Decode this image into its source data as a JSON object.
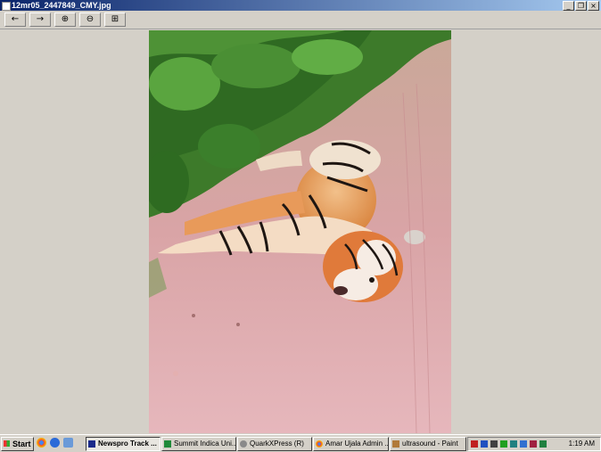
{
  "window": {
    "title": "12mr05_2447849_CMY.jpg",
    "minimize_glyph": "_",
    "restore_glyph": "❐",
    "close_glyph": "×"
  },
  "toolbar": {
    "back_glyph": "←",
    "forward_glyph": "→",
    "zoom_in_glyph": "⊕",
    "zoom_out_glyph": "⊖",
    "fit_glyph": "⊞"
  },
  "taskbar": {
    "start_label": "Start",
    "tasks": [
      {
        "label": "Newspro Track ...",
        "icon": "newspro-icon"
      },
      {
        "label": "Summit Indica Uni...",
        "icon": "excel-icon"
      },
      {
        "label": "QuarkXPress (R)",
        "icon": "quark-icon"
      },
      {
        "label": "Amar Ujala Admin ...",
        "icon": "chrome-icon"
      },
      {
        "label": "ultrasound - Paint",
        "icon": "paint-icon"
      }
    ],
    "clock": "1:19 AM"
  },
  "colors": {
    "titlebar_start": "#0a246a",
    "titlebar_end": "#a6caf0",
    "chrome": "#d4d0c8"
  }
}
